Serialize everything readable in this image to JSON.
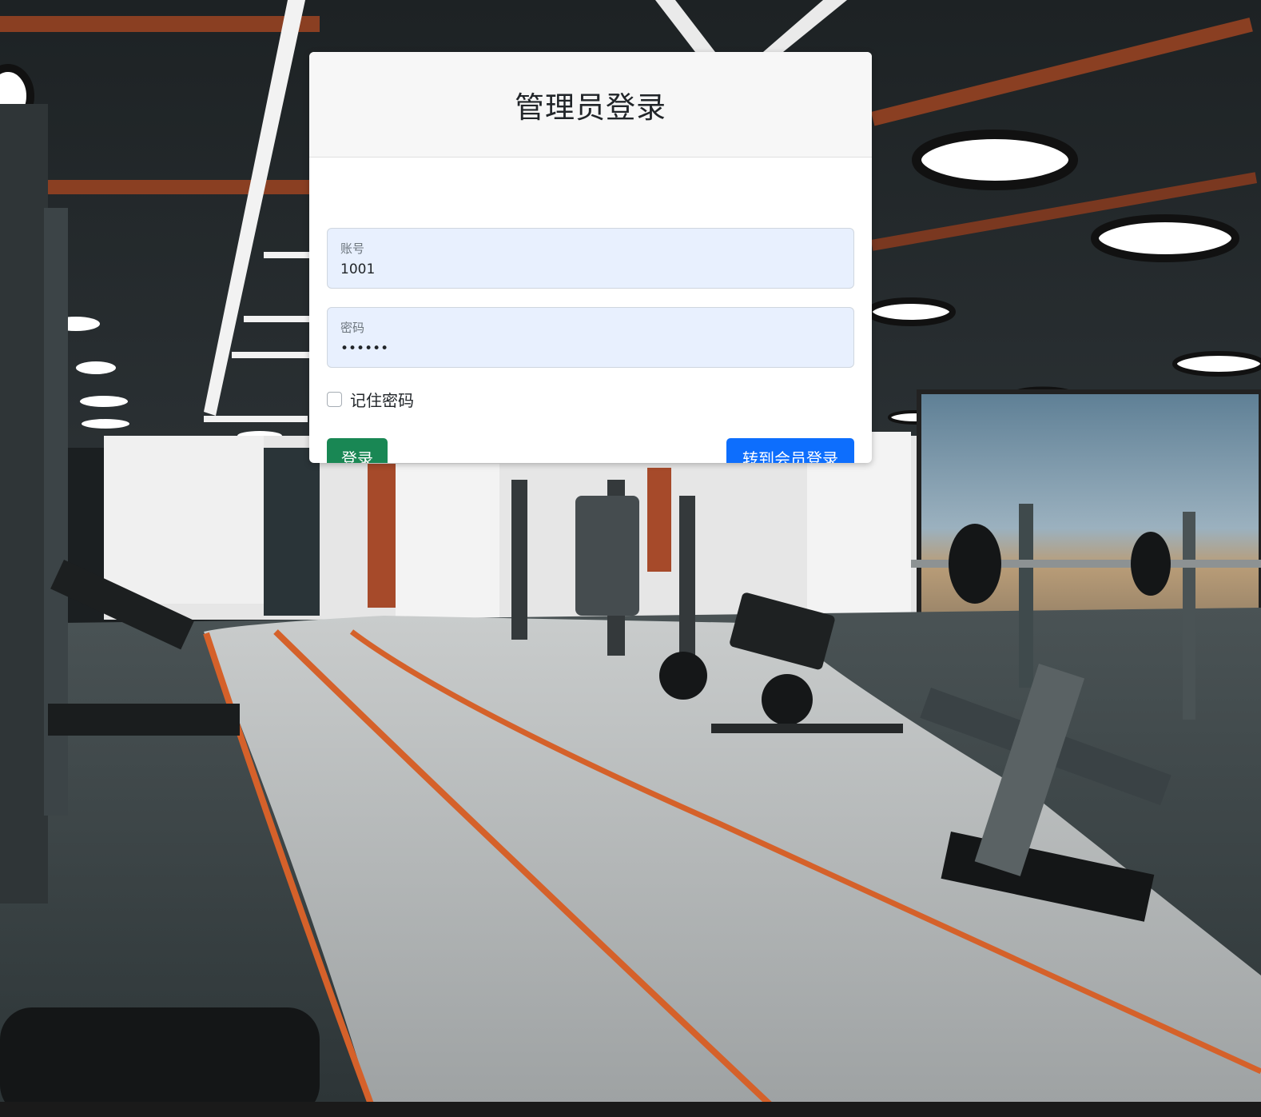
{
  "login": {
    "title": "管理员登录",
    "account_label": "账号",
    "account_value": "1001",
    "password_label": "密码",
    "password_value": "••••••",
    "remember_label": "记住密码",
    "remember_checked": false,
    "login_button": "登录",
    "member_login_button": "转到会员登录"
  },
  "colors": {
    "login_button": "#198754",
    "member_button": "#0d6efd",
    "input_fill": "#e8f0fe",
    "header_fill": "#f7f7f7"
  }
}
